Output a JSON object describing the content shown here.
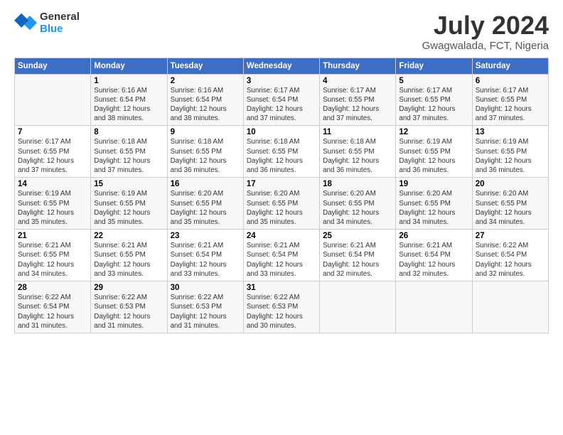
{
  "logo": {
    "line1": "General",
    "line2": "Blue"
  },
  "title": "July 2024",
  "subtitle": "Gwagwalada, FCT, Nigeria",
  "weekdays": [
    "Sunday",
    "Monday",
    "Tuesday",
    "Wednesday",
    "Thursday",
    "Friday",
    "Saturday"
  ],
  "weeks": [
    [
      {
        "day": "",
        "sunrise": "",
        "sunset": "",
        "daylight": ""
      },
      {
        "day": "1",
        "sunrise": "6:16 AM",
        "sunset": "6:54 PM",
        "daylight": "12 hours and 38 minutes."
      },
      {
        "day": "2",
        "sunrise": "6:16 AM",
        "sunset": "6:54 PM",
        "daylight": "12 hours and 38 minutes."
      },
      {
        "day": "3",
        "sunrise": "6:17 AM",
        "sunset": "6:54 PM",
        "daylight": "12 hours and 37 minutes."
      },
      {
        "day": "4",
        "sunrise": "6:17 AM",
        "sunset": "6:55 PM",
        "daylight": "12 hours and 37 minutes."
      },
      {
        "day": "5",
        "sunrise": "6:17 AM",
        "sunset": "6:55 PM",
        "daylight": "12 hours and 37 minutes."
      },
      {
        "day": "6",
        "sunrise": "6:17 AM",
        "sunset": "6:55 PM",
        "daylight": "12 hours and 37 minutes."
      }
    ],
    [
      {
        "day": "7",
        "sunrise": "6:17 AM",
        "sunset": "6:55 PM",
        "daylight": "12 hours and 37 minutes."
      },
      {
        "day": "8",
        "sunrise": "6:18 AM",
        "sunset": "6:55 PM",
        "daylight": "12 hours and 37 minutes."
      },
      {
        "day": "9",
        "sunrise": "6:18 AM",
        "sunset": "6:55 PM",
        "daylight": "12 hours and 36 minutes."
      },
      {
        "day": "10",
        "sunrise": "6:18 AM",
        "sunset": "6:55 PM",
        "daylight": "12 hours and 36 minutes."
      },
      {
        "day": "11",
        "sunrise": "6:18 AM",
        "sunset": "6:55 PM",
        "daylight": "12 hours and 36 minutes."
      },
      {
        "day": "12",
        "sunrise": "6:19 AM",
        "sunset": "6:55 PM",
        "daylight": "12 hours and 36 minutes."
      },
      {
        "day": "13",
        "sunrise": "6:19 AM",
        "sunset": "6:55 PM",
        "daylight": "12 hours and 36 minutes."
      }
    ],
    [
      {
        "day": "14",
        "sunrise": "6:19 AM",
        "sunset": "6:55 PM",
        "daylight": "12 hours and 35 minutes."
      },
      {
        "day": "15",
        "sunrise": "6:19 AM",
        "sunset": "6:55 PM",
        "daylight": "12 hours and 35 minutes."
      },
      {
        "day": "16",
        "sunrise": "6:20 AM",
        "sunset": "6:55 PM",
        "daylight": "12 hours and 35 minutes."
      },
      {
        "day": "17",
        "sunrise": "6:20 AM",
        "sunset": "6:55 PM",
        "daylight": "12 hours and 35 minutes."
      },
      {
        "day": "18",
        "sunrise": "6:20 AM",
        "sunset": "6:55 PM",
        "daylight": "12 hours and 34 minutes."
      },
      {
        "day": "19",
        "sunrise": "6:20 AM",
        "sunset": "6:55 PM",
        "daylight": "12 hours and 34 minutes."
      },
      {
        "day": "20",
        "sunrise": "6:20 AM",
        "sunset": "6:55 PM",
        "daylight": "12 hours and 34 minutes."
      }
    ],
    [
      {
        "day": "21",
        "sunrise": "6:21 AM",
        "sunset": "6:55 PM",
        "daylight": "12 hours and 34 minutes."
      },
      {
        "day": "22",
        "sunrise": "6:21 AM",
        "sunset": "6:55 PM",
        "daylight": "12 hours and 33 minutes."
      },
      {
        "day": "23",
        "sunrise": "6:21 AM",
        "sunset": "6:54 PM",
        "daylight": "12 hours and 33 minutes."
      },
      {
        "day": "24",
        "sunrise": "6:21 AM",
        "sunset": "6:54 PM",
        "daylight": "12 hours and 33 minutes."
      },
      {
        "day": "25",
        "sunrise": "6:21 AM",
        "sunset": "6:54 PM",
        "daylight": "12 hours and 32 minutes."
      },
      {
        "day": "26",
        "sunrise": "6:21 AM",
        "sunset": "6:54 PM",
        "daylight": "12 hours and 32 minutes."
      },
      {
        "day": "27",
        "sunrise": "6:22 AM",
        "sunset": "6:54 PM",
        "daylight": "12 hours and 32 minutes."
      }
    ],
    [
      {
        "day": "28",
        "sunrise": "6:22 AM",
        "sunset": "6:54 PM",
        "daylight": "12 hours and 31 minutes."
      },
      {
        "day": "29",
        "sunrise": "6:22 AM",
        "sunset": "6:53 PM",
        "daylight": "12 hours and 31 minutes."
      },
      {
        "day": "30",
        "sunrise": "6:22 AM",
        "sunset": "6:53 PM",
        "daylight": "12 hours and 31 minutes."
      },
      {
        "day": "31",
        "sunrise": "6:22 AM",
        "sunset": "6:53 PM",
        "daylight": "12 hours and 30 minutes."
      },
      {
        "day": "",
        "sunrise": "",
        "sunset": "",
        "daylight": ""
      },
      {
        "day": "",
        "sunrise": "",
        "sunset": "",
        "daylight": ""
      },
      {
        "day": "",
        "sunrise": "",
        "sunset": "",
        "daylight": ""
      }
    ]
  ],
  "labels": {
    "sunrise": "Sunrise:",
    "sunset": "Sunset:",
    "daylight": "Daylight: "
  }
}
